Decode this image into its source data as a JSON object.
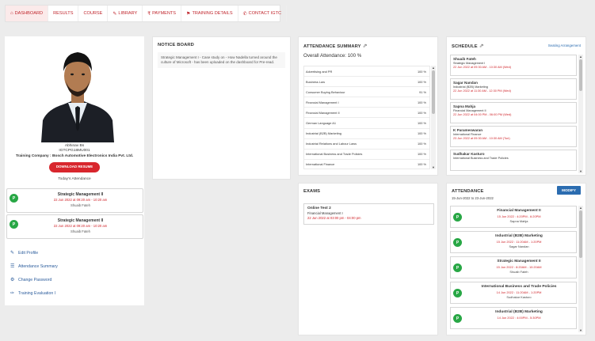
{
  "nav": {
    "tabs": [
      {
        "icon": "home-icon",
        "glyph": "⌂",
        "label": "DASHBOARD"
      },
      {
        "icon": "",
        "glyph": "",
        "label": "RESULTS"
      },
      {
        "icon": "",
        "glyph": "",
        "label": "COURSE"
      },
      {
        "icon": "pencil-icon",
        "glyph": "✎",
        "label": "LIBRARY"
      },
      {
        "icon": "rupee-icon",
        "glyph": "₹",
        "label": "PAYMENTS"
      },
      {
        "icon": "bookmark-icon",
        "glyph": "⚑",
        "label": "TRAINING DETAILS"
      },
      {
        "icon": "phone-icon",
        "glyph": "✆",
        "label": "CONTACT IGTC"
      }
    ]
  },
  "profile": {
    "name": "Abhinav Bs",
    "id": "IGTCPG18MU001",
    "company": "Training Company : Bosch Automotive Electronics India Pvt. Ltd.",
    "download_label": "DOWNLOAD RESUME",
    "today_label": "Today's Attendance",
    "sessions": [
      {
        "badge": "P",
        "title": "Strategic Management II",
        "datetime": "22 Jun 2022 at 09:20 am - 10:20 am",
        "faculty": "Shuaib Fateh"
      },
      {
        "badge": "P",
        "title": "Strategic Management II",
        "datetime": "22 Jun 2022 at 09:20 am - 10:20 am",
        "faculty": "Shuaib Fateh"
      }
    ],
    "links": [
      {
        "glyph": "✎",
        "label": "Edit Profile"
      },
      {
        "glyph": "☰",
        "label": "Attendance Summary"
      },
      {
        "glyph": "⚙",
        "label": "Change Password"
      },
      {
        "glyph": "✑",
        "label": "Training Evaluation I"
      }
    ]
  },
  "notice": {
    "title": "NOTICE BOARD",
    "text": "Strategic Management I - Case study on - How Nadella turned around the culture of Microsoft - has been uploaded on the dashboard for Pre-read."
  },
  "attendance_summary": {
    "title": "ATTENDANCE SUMMARY",
    "overall": "Overall Attendance: 100 %",
    "rows": [
      {
        "subject": "Advertising and PR",
        "pct": "100 %"
      },
      {
        "subject": "Business Law",
        "pct": "100 %"
      },
      {
        "subject": "Consumer Buying Behaviour",
        "pct": "91 %"
      },
      {
        "subject": "Financial Management I",
        "pct": "100 %"
      },
      {
        "subject": "Financial Management II",
        "pct": "100 %"
      },
      {
        "subject": "German Language A1",
        "pct": "100 %"
      },
      {
        "subject": "Industrial (B2B) Marketing",
        "pct": "100 %"
      },
      {
        "subject": "Industrial Relations and Labour Laws",
        "pct": "100 %"
      },
      {
        "subject": "International Business and Trade Policies",
        "pct": "100 %"
      },
      {
        "subject": "International Finance",
        "pct": "100 %"
      }
    ]
  },
  "exams": {
    "title": "EXAMS",
    "items": [
      {
        "title": "Online Test 2",
        "subject": "Financial Management I",
        "datetime": "22 Jun 2022 at 03:00 pm - 04:00 pm"
      }
    ]
  },
  "schedule": {
    "title": "SCHEDULE",
    "seating_label": "Seating Arrangement",
    "items": [
      {
        "name": "Shuaib Fateh",
        "subject": "Strategic Management I",
        "datetime": "22 Jun 2022 at 09:30 AM - 10:30 AM (Wed)"
      },
      {
        "name": "Sagar Nandan",
        "subject": "Industrial (B2B) Marketing",
        "datetime": "22 Jun 2022 at 11:30 AM - 12:30 PM (Wed)"
      },
      {
        "name": "Sapna Mahja",
        "subject": "Financial Management II",
        "datetime": "22 Jun 2022 at 04:00 PM - 06:00 PM (Wed)"
      },
      {
        "name": "K Parameswaran",
        "subject": "International Finance",
        "datetime": "23 Jun 2022 at 09:30 AM - 10:30 AM (Tue)"
      },
      {
        "name": "Sudhakar Kasturo",
        "subject": "International Business and Trade Policies",
        "datetime": ""
      }
    ]
  },
  "attendance": {
    "title": "ATTENDANCE",
    "modify_label": "MODIFY",
    "range": "15-Jun-2022 to 23-Jun-2022",
    "items": [
      {
        "badge": "P",
        "title": "Financial Management II",
        "datetime": "15 Jun 2022 : 4:20PM - 6:20PM",
        "faculty": "Sapna Mahja"
      },
      {
        "badge": "P",
        "title": "Industrial (B2B) Marketing",
        "datetime": "15 Jun 2022 : 11:20AM - 1:20PM",
        "faculty": "Sagar Nandan"
      },
      {
        "badge": "P",
        "title": "Strategic Management II",
        "datetime": "15 Jun 2022 : 8:20AM - 10:20AM",
        "faculty": "Shuaib Fateh"
      },
      {
        "badge": "P",
        "title": "International Business and Trade Policies",
        "datetime": "14 Jun 2022 : 11:20AM - 1:20PM",
        "faculty": "Sudhakar Kasturo"
      },
      {
        "badge": "P",
        "title": "Industrial (B2B) Marketing",
        "datetime": "14 Jun 2022 : 4:00PM - 5:30PM",
        "faculty": ""
      }
    ]
  }
}
